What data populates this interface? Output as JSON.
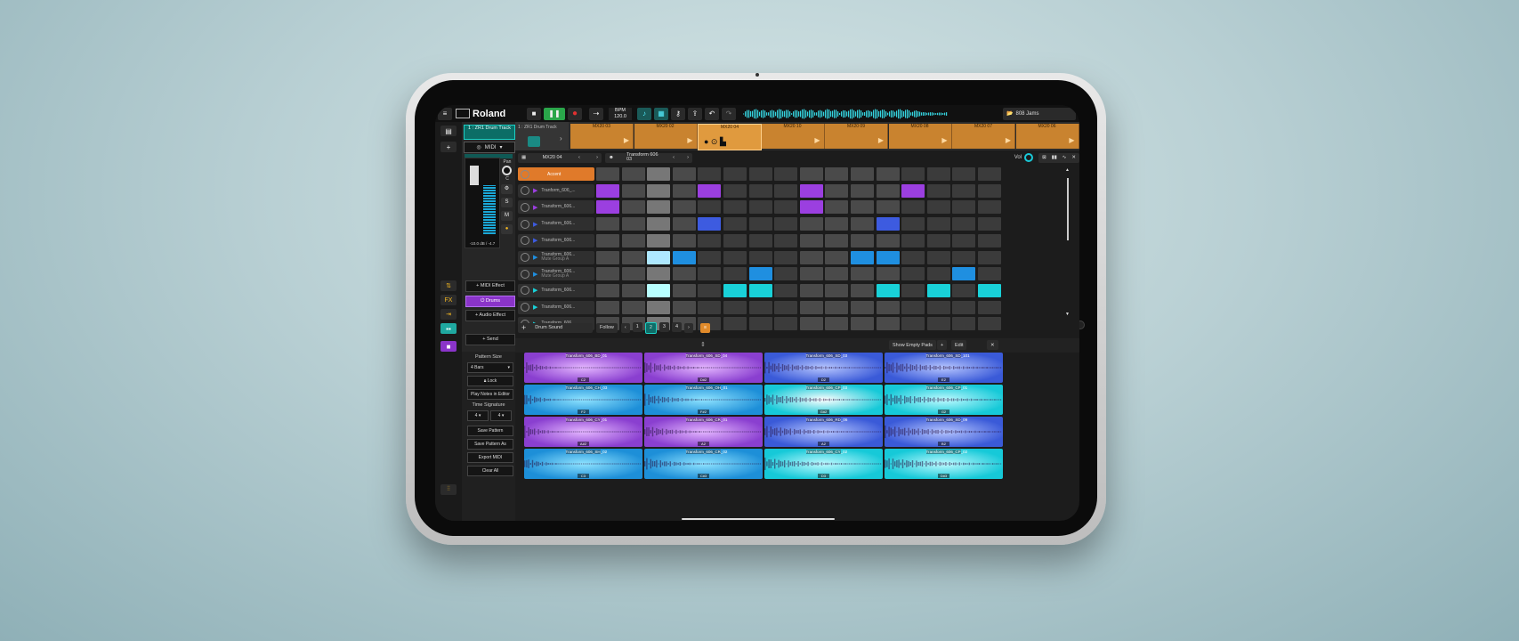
{
  "toolbar": {
    "brand": "Roland",
    "bpm_label": "BPM",
    "bpm_value": "120.0",
    "jams": "808 Jams"
  },
  "track": {
    "name": "1 : ZR1 Drum Track",
    "midi": "MIDI",
    "pan": "Pan",
    "pan_value": "C",
    "db": "-10.0 dB / -4.7",
    "s": "S",
    "m": "M",
    "midi_effect": "+ MIDI Effect",
    "drums": "Drums",
    "audio_effect": "+ Audio Effect",
    "send": "+ Send"
  },
  "pattern": {
    "size_label": "Pattern Size",
    "size": "4 Bars",
    "lock": "Lock",
    "play_notes": "Play Notes in Editor",
    "timesig_label": "Time Signature",
    "num": "4",
    "den": "4",
    "save": "Save Pattern",
    "save_as": "Save Pattern As",
    "export": "Export MIDI",
    "clear": "Clear All"
  },
  "clips": {
    "info": "1 : ZR1 Drum Track",
    "items": [
      "MX20 03",
      "MX20 02",
      "MX20 04",
      "MX20 10",
      "MX20 09",
      "MX20 08",
      "MX20 07",
      "MX20 06"
    ]
  },
  "editor": {
    "clip": "MX20 04",
    "sound": "Transform 606 03",
    "vol": "Vol",
    "rows": [
      "Accent",
      "Tranform_606_...",
      "Transform_606...",
      "Transform_606...",
      "Transform_606...",
      "Transform_606...",
      "Transform_606...",
      "Transform_606...",
      "Transform_606...",
      "Transform_606..."
    ],
    "subrows": {
      "5": "Mute Group A",
      "6": "Mute Group A"
    },
    "drum_sound": "Drum Sound",
    "follow": "Follow",
    "pages": [
      "1",
      "2",
      "3",
      "4"
    ],
    "show_empty": "Show Empty Pads",
    "edit": "Edit"
  },
  "pads": [
    {
      "name": "Transform_606_BD_01",
      "key": "C2",
      "c1": "#8a3fd0",
      "c2": "#e4b6ff"
    },
    {
      "name": "Transform_606_SD_04",
      "key": "D#2",
      "c1": "#8a3fd0",
      "c2": "#e4b6ff"
    },
    {
      "name": "Transform_606_SD_03",
      "key": "D2",
      "c1": "#3a5ad8",
      "c2": "#b7c6ff"
    },
    {
      "name": "Transform_606_SD_101",
      "key": "E2",
      "c1": "#3a5ad8",
      "c2": "#b7c6ff"
    },
    {
      "name": "Transform_606_CH_03",
      "key": "F2",
      "c1": "#1d8fd8",
      "c2": "#8fe3ff"
    },
    {
      "name": "Transform_606_OH_01",
      "key": "F#2",
      "c1": "#1d8fd8",
      "c2": "#8fe3ff"
    },
    {
      "name": "Transform_606_CP_03",
      "key": "G#2",
      "c1": "#16c9d8",
      "c2": "#ffffff"
    },
    {
      "name": "Transform_606_CP_01",
      "key": "G2",
      "c1": "#16c9d8",
      "c2": "#bffaff"
    },
    {
      "name": "Transform_606_CY_01",
      "key": "A#2",
      "c1": "#8a3fd0",
      "c2": "#e4b6ff"
    },
    {
      "name": "Transform_606_CR_01",
      "key": "A2",
      "c1": "#8a3fd0",
      "c2": "#e4b6ff"
    },
    {
      "name": "Transform_606_RD_06",
      "key": "A2",
      "c1": "#3a5ad8",
      "c2": "#b7c6ff"
    },
    {
      "name": "Transform_606_SD_09",
      "key": "B2",
      "c1": "#3a5ad8",
      "c2": "#b7c6ff"
    },
    {
      "name": "Transform_606_SH_02",
      "key": "C3",
      "c1": "#1d8fd8",
      "c2": "#8fe3ff"
    },
    {
      "name": "Transform_606_CR_02",
      "key": "C#3",
      "c1": "#1d8fd8",
      "c2": "#8fe3ff"
    },
    {
      "name": "Transform_606_CY_02",
      "key": "D3",
      "c1": "#16c9d8",
      "c2": "#bffaff"
    },
    {
      "name": "Transform_606_CP_02",
      "key": "D#3",
      "c1": "#16c9d8",
      "c2": "#bffaff"
    }
  ],
  "grid": {
    "steps": 16,
    "active": [
      [],
      [
        0,
        4,
        8,
        12
      ],
      [
        0,
        8
      ],
      [
        4,
        11
      ],
      [],
      [
        2,
        3,
        10,
        11
      ],
      [
        6,
        14
      ],
      [
        2,
        5,
        6,
        11,
        13,
        15
      ],
      [],
      []
    ],
    "row_colors": [
      "#e07a2a",
      "#9b3fe0",
      "#9b3fe0",
      "#3d5be0",
      "#3d5be0",
      "#1f8fe0",
      "#1f8fe0",
      "#19d1d8",
      "#19d1d8",
      "#19d1d8"
    ],
    "light_steps": [
      2
    ]
  }
}
